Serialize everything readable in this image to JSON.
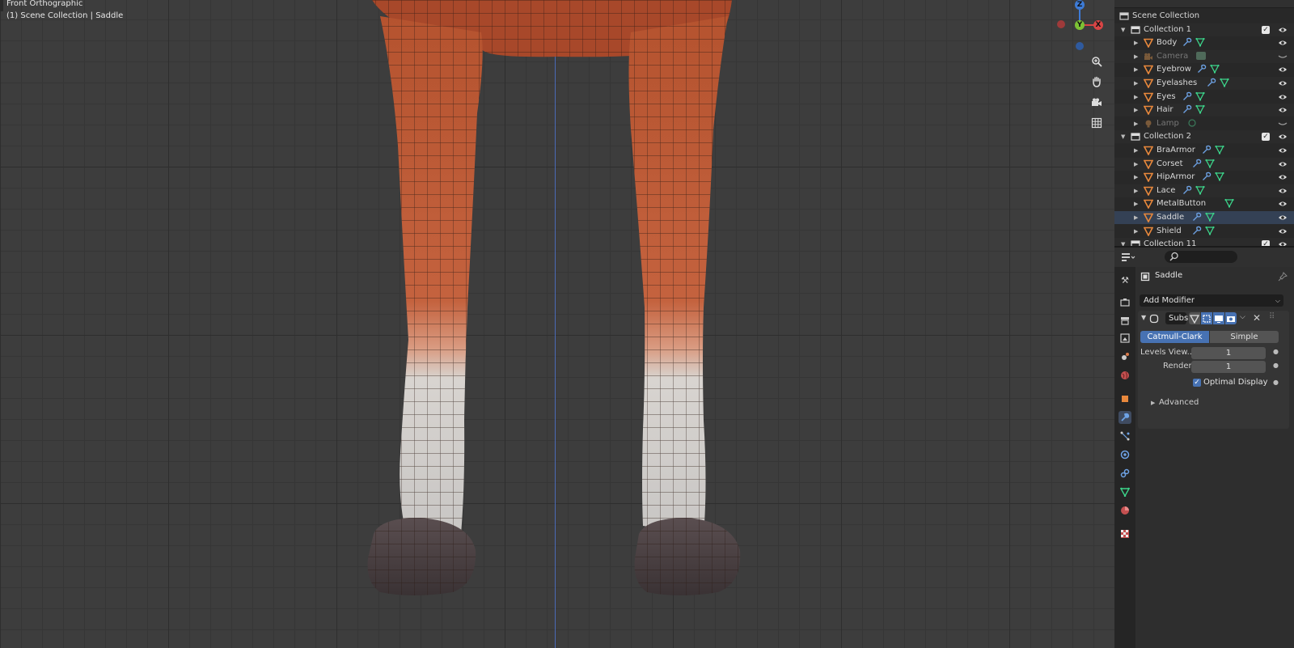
{
  "viewport": {
    "view_name": "Front Orthographic",
    "context": "(1) Scene Collection | Saddle",
    "gizmo_axes": [
      "Z",
      "Y",
      "X"
    ]
  },
  "outliner": {
    "rows": [
      {
        "label": "Scene Collection",
        "type": "scene",
        "level": 0
      },
      {
        "label": "Collection 1",
        "type": "collection",
        "level": 1,
        "expanded": true
      },
      {
        "label": "Body",
        "type": "mesh",
        "level": 2,
        "mods": true
      },
      {
        "label": "Camera",
        "type": "camera",
        "level": 2,
        "dim": true
      },
      {
        "label": "Eyebrow",
        "type": "mesh",
        "level": 2,
        "mods": true
      },
      {
        "label": "Eyelashes",
        "type": "mesh",
        "level": 2,
        "mods": true
      },
      {
        "label": "Eyes",
        "type": "mesh",
        "level": 2,
        "mods": true
      },
      {
        "label": "Hair",
        "type": "mesh",
        "level": 2,
        "mods": true
      },
      {
        "label": "Lamp",
        "type": "lamp",
        "level": 2,
        "dim": true
      },
      {
        "label": "Collection 2",
        "type": "collection",
        "level": 1,
        "expanded": true
      },
      {
        "label": "BraArmor",
        "type": "mesh",
        "level": 2,
        "mods": true
      },
      {
        "label": "Corset",
        "type": "mesh",
        "level": 2,
        "mods": true
      },
      {
        "label": "HipArmor",
        "type": "mesh",
        "level": 2,
        "mods": true
      },
      {
        "label": "Lace",
        "type": "mesh",
        "level": 2,
        "mods": true
      },
      {
        "label": "MetalButton",
        "type": "mesh",
        "level": 2,
        "mods": false
      },
      {
        "label": "Saddle",
        "type": "mesh",
        "level": 2,
        "mods": true,
        "selected": true
      },
      {
        "label": "Shield",
        "type": "mesh",
        "level": 2,
        "mods": true
      },
      {
        "label": "Collection 11",
        "type": "collection",
        "level": 1,
        "expanded": true
      }
    ]
  },
  "properties": {
    "object_name": "Saddle",
    "add_modifier": "Add Modifier",
    "modifier_name": "Subs",
    "subdiv_types": [
      "Catmull-Clark",
      "Simple"
    ],
    "levels_viewport_label": "Levels View...",
    "levels_viewport": "1",
    "render_label": "Render",
    "render": "1",
    "optimal_display_label": "Optimal Display",
    "advanced_label": "Advanced"
  },
  "colors": {
    "accent": "#4772b3",
    "mesh_icon": "#e8883c",
    "modifier_icon": "#6ea3e6",
    "data_icon": "#3cd48a"
  }
}
